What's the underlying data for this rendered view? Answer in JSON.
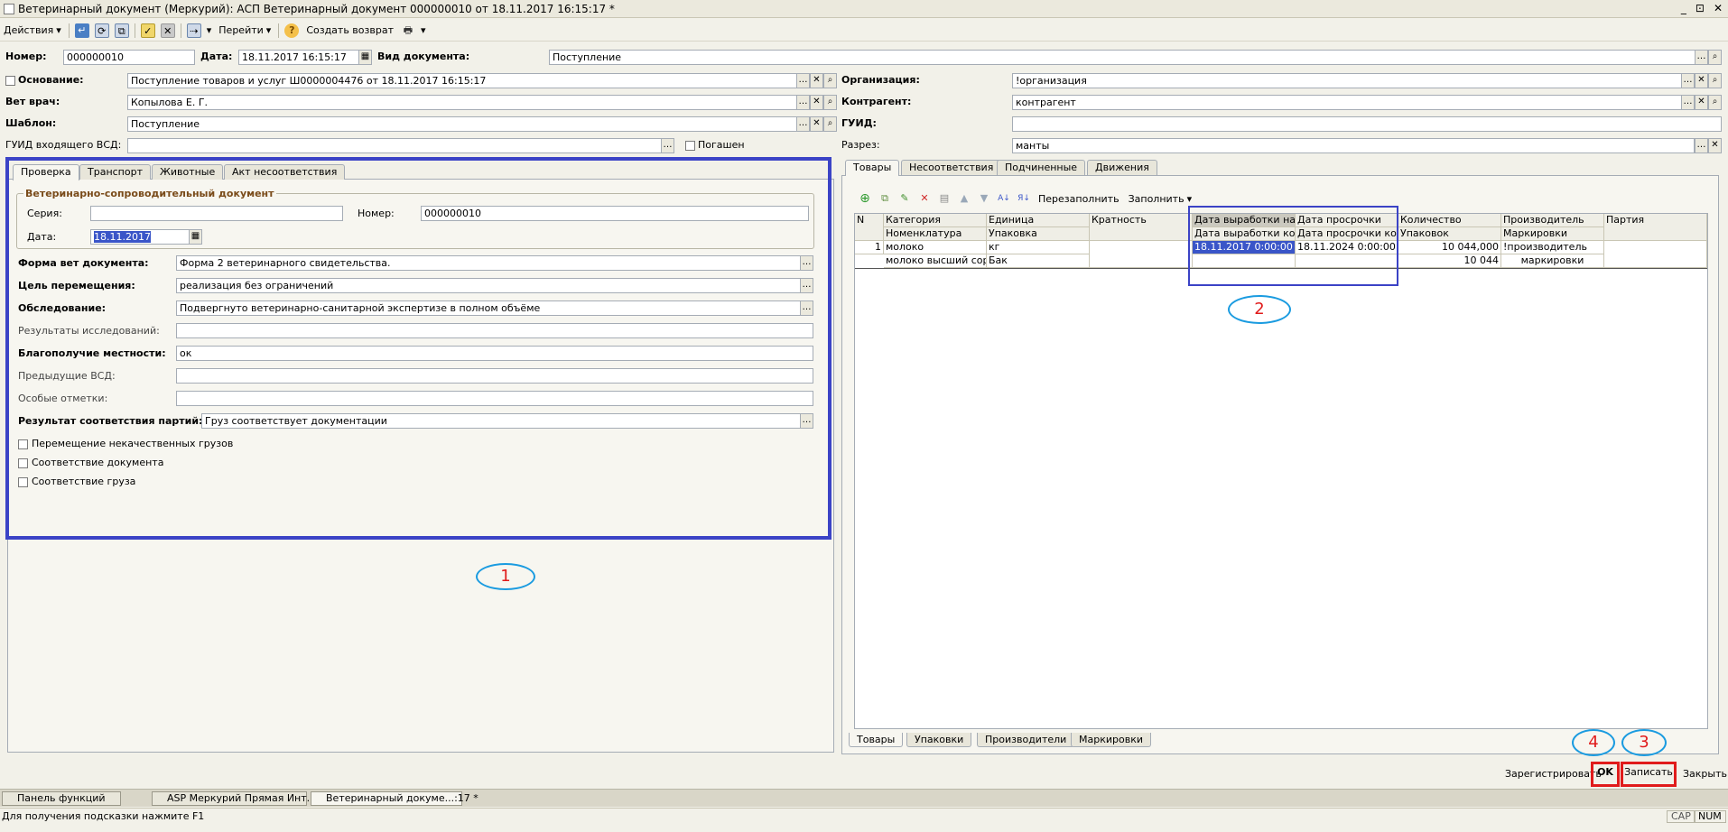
{
  "window": {
    "title": "Ветеринарный документ (Меркурий): АСП Ветеринарный документ 000000010 от 18.11.2017 16:15:17 *",
    "buttons": [
      "_",
      "⊡",
      "✕"
    ]
  },
  "toolbar": {
    "actions": "Действия",
    "goto": "Перейти",
    "create_return": "Создать возврат"
  },
  "header": {
    "number_label": "Номер:",
    "number_value": "000000010",
    "date_label": "Дата:",
    "date_value": "18.11.2017 16:15:17",
    "doctype_label": "Вид документа:",
    "doctype_value": "Поступление",
    "basis_label": "Основание:",
    "basis_value": "Поступление товаров и услуг Ш0000004476 от 18.11.2017 16:15:17",
    "vet_label": "Вет врач:",
    "vet_value": "Копылова Е. Г.",
    "template_label": "Шаблон:",
    "template_value": "Поступление",
    "guid_in_label": "ГУИД входящего ВСД:",
    "guid_in_value": "",
    "repaid_label": "Погашен",
    "org_label": "Организация:",
    "org_value": "!организация",
    "contractor_label": "Контрагент:",
    "contractor_value": "контрагент",
    "guid_label": "ГУИД:",
    "guid_value": "",
    "cut_label": "Разрез:",
    "cut_value": "манты"
  },
  "left_tabs": [
    "Проверка",
    "Транспорт",
    "Животные",
    "Акт несоответствия"
  ],
  "check": {
    "group_title": "Ветеринарно-сопроводительный документ",
    "series_label": "Серия:",
    "series_value": "",
    "num_label": "Номер:",
    "num_value": "000000010",
    "date_label": "Дата:",
    "date_value": "18.11.2017",
    "form_label": "Форма вет документа:",
    "form_value": "Форма 2 ветеринарного свидетельства.",
    "purpose_label": "Цель перемещения:",
    "purpose_value": "реализация без ограничений",
    "exam_label": "Обследование:",
    "exam_value": "Подвергнуто ветеринарно-санитарной экспертизе в полном объёме",
    "results_label": "Результаты исследований:",
    "results_value": "",
    "welfare_label": "Благополучие местности:",
    "welfare_value": "ок",
    "prev_label": "Предыдущие ВСД:",
    "prev_value": "",
    "notes_label": "Особые отметки:",
    "notes_value": "",
    "batch_label": "Результат соответствия партий:",
    "batch_value": "Груз соответствует документации",
    "cb1": "Перемещение некачественных грузов",
    "cb2": "Соответствие документа",
    "cb3": "Соответствие груза"
  },
  "right_tabs": [
    "Товары",
    "Несоответствия",
    "Подчиненные",
    "Движения"
  ],
  "grid_toolbar": {
    "refill": "Перезаполнить",
    "fill": "Заполнить"
  },
  "grid": {
    "headers_top": [
      "N",
      "Категория",
      "Единица",
      "Кратность",
      "Дата выработки нач.",
      "Дата просрочки",
      "Количество",
      "Производитель",
      "Партия"
    ],
    "headers_bottom": [
      "",
      "Номенклатура",
      "Упаковка",
      "",
      "Дата выработки кон.",
      "Дата просрочки кон.",
      "Упаковок",
      "Маркировки",
      ""
    ],
    "row1_top": [
      "1",
      "молоко",
      "кг",
      "",
      "18.11.2017 0:00:00",
      "18.11.2024 0:00:00",
      "10 044,000",
      "!производитель",
      ""
    ],
    "row1_bottom": [
      "",
      "молоко высший сорт",
      "Бак",
      "",
      "",
      "",
      "10 044",
      "маркировки",
      ""
    ]
  },
  "bottom_tabs": [
    "Товары",
    "Упаковки",
    "Производители",
    "Маркировки"
  ],
  "annotations": [
    "1",
    "2",
    "3",
    "4"
  ],
  "footer": {
    "register": "Зарегистрировать",
    "ok": "OK",
    "save": "Записать",
    "close": "Закрыть"
  },
  "taskbar": [
    "Панель функций",
    "ASP Меркурий Прямая Инт...",
    "Ветеринарный докуме...:17 *"
  ],
  "status": {
    "hint": "Для получения подсказки нажмите F1",
    "cap": "CAP",
    "num": "NUM"
  },
  "colors": {
    "highlight_blue": "#3b43c6",
    "highlight_red": "#e01b1b",
    "annotation_ellipse": "#1a9be0",
    "selection": "#3a55c8"
  }
}
